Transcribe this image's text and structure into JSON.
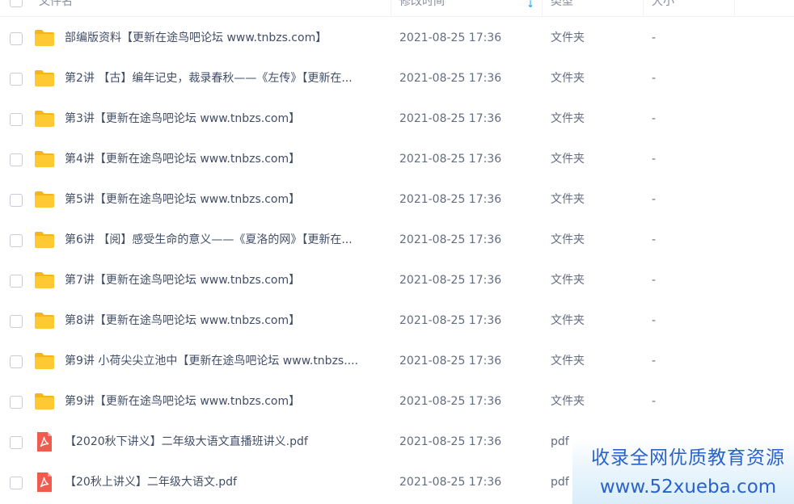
{
  "header": {
    "col_name": "文件名",
    "col_time": "修改时间",
    "col_type": "类型",
    "col_size": "大小",
    "sort_indicator": "↓"
  },
  "files": [
    {
      "name": "部编版资料【更新在途鸟吧论坛 www.tnbzs.com】",
      "time": "2021-08-25 17:36",
      "type": "文件夹",
      "size": "-",
      "icon": "folder-icon"
    },
    {
      "name": "第2讲 【古】编年记史，裁录春秋——《左传》【更新在...",
      "time": "2021-08-25 17:36",
      "type": "文件夹",
      "size": "-",
      "icon": "folder-icon"
    },
    {
      "name": "第3讲【更新在途鸟吧论坛 www.tnbzs.com】",
      "time": "2021-08-25 17:36",
      "type": "文件夹",
      "size": "-",
      "icon": "folder-icon"
    },
    {
      "name": "第4讲【更新在途鸟吧论坛 www.tnbzs.com】",
      "time": "2021-08-25 17:36",
      "type": "文件夹",
      "size": "-",
      "icon": "folder-icon"
    },
    {
      "name": "第5讲【更新在途鸟吧论坛 www.tnbzs.com】",
      "time": "2021-08-25 17:36",
      "type": "文件夹",
      "size": "-",
      "icon": "folder-icon"
    },
    {
      "name": "第6讲 【阅】感受生命的意义——《夏洛的网》【更新在...",
      "time": "2021-08-25 17:36",
      "type": "文件夹",
      "size": "-",
      "icon": "folder-icon"
    },
    {
      "name": "第7讲【更新在途鸟吧论坛 www.tnbzs.com】",
      "time": "2021-08-25 17:36",
      "type": "文件夹",
      "size": "-",
      "icon": "folder-icon"
    },
    {
      "name": "第8讲【更新在途鸟吧论坛 www.tnbzs.com】",
      "time": "2021-08-25 17:36",
      "type": "文件夹",
      "size": "-",
      "icon": "folder-icon"
    },
    {
      "name": "第9讲 小荷尖尖立池中【更新在途鸟吧论坛 www.tnbzs....",
      "time": "2021-08-25 17:36",
      "type": "文件夹",
      "size": "-",
      "icon": "folder-icon"
    },
    {
      "name": "第9讲【更新在途鸟吧论坛 www.tnbzs.com】",
      "time": "2021-08-25 17:36",
      "type": "文件夹",
      "size": "-",
      "icon": "folder-icon"
    },
    {
      "name": "【2020秋下讲义】二年级大语文直播班讲义.pdf",
      "time": "2021-08-25 17:36",
      "type": "pdf",
      "size": "",
      "icon": "pdf-icon"
    },
    {
      "name": "【20秋上讲义】二年级大语文.pdf",
      "time": "2021-08-25 17:36",
      "type": "pdf",
      "size": "",
      "icon": "pdf-icon"
    }
  ],
  "watermark": {
    "line1": "收录全网优质教育资源",
    "line2": "www.52xueba.com"
  },
  "colors": {
    "folder": "#ffc933",
    "folder_tab": "#f5b51f",
    "pdf": "#f05a4f",
    "accent": "#06a7ff",
    "watermark_text": "#2a62c9"
  }
}
